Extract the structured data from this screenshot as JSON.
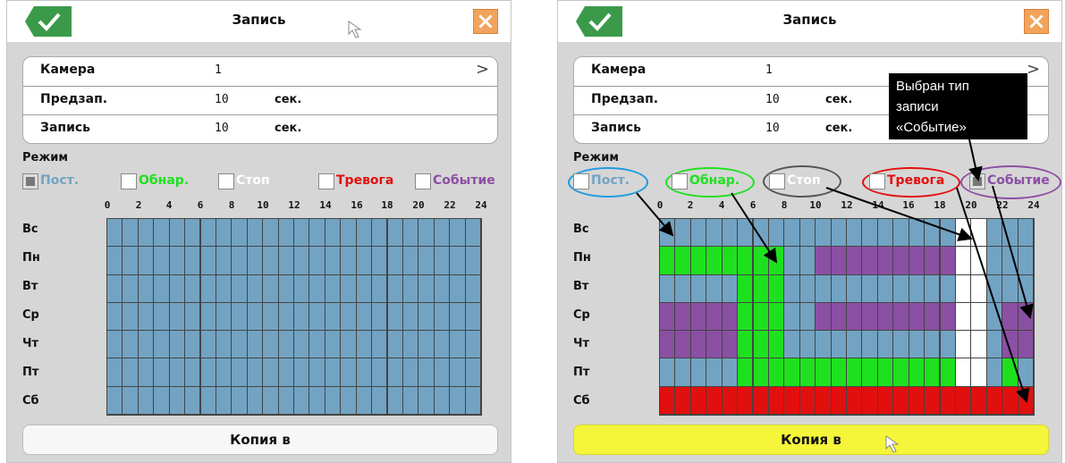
{
  "title": "Запись",
  "settings": {
    "camera": {
      "label": "Камера",
      "value": "1",
      "chevron": ">"
    },
    "prerecord": {
      "label": "Предзап.",
      "value": "10",
      "unit": "сек."
    },
    "record": {
      "label": "Запись",
      "value": "10",
      "unit": "сек."
    }
  },
  "mode_title": "Режим",
  "modes": [
    {
      "label": "Пост.",
      "color": "#72a3c3"
    },
    {
      "label": "Обнар.",
      "color": "#1fe01f"
    },
    {
      "label": "Стоп",
      "color": "#ffffff"
    },
    {
      "label": "Тревога",
      "color": "#e20f0f"
    },
    {
      "label": "Событие",
      "color": "#8b4fa3"
    }
  ],
  "selected_mode": {
    "before": "Пост.",
    "after": "Событие"
  },
  "hour_labels": [
    "0",
    "2",
    "4",
    "6",
    "8",
    "10",
    "12",
    "14",
    "16",
    "18",
    "20",
    "22",
    "24"
  ],
  "days": [
    "Вс",
    "Пн",
    "Вт",
    "Ср",
    "Чт",
    "Пт",
    "Сб"
  ],
  "copy_button": "Копия в",
  "callout": {
    "line1": "Выбран тип",
    "line2": "записи",
    "line3": "«Событие»"
  },
  "schedule_colors": {
    "P": "#72a3c3",
    "G": "#1fe01f",
    "W": "#ffffff",
    "R": "#e20f0f",
    "E": "#8b4fa3"
  },
  "schedule_before": [
    "PPPPPPPPPPPPPPPPPPPPPPPP",
    "PPPPPPPPPPPPPPPPPPPPPPPP",
    "PPPPPPPPPPPPPPPPPPPPPPPP",
    "PPPPPPPPPPPPPPPPPPPPPPPP",
    "PPPPPPPPPPPPPPPPPPPPPPPP",
    "PPPPPPPPPPPPPPPPPPPPPPPP",
    "PPPPPPPPPPPPPPPPPPPPPPPP"
  ],
  "schedule_after": [
    "PPPPPPPPPPPPPPPPPPPWWPPP",
    "GGGGGGGGPPEEEEEEEEEWWPPP",
    "PPPPPGGGPPPPPPPPPPPWWPPP",
    "EEEEEGGGPPEEEEEEEEEWWPEE",
    "EEEEEGGGPPPPPPPPPPPWWPEE",
    "PPPPPGGGGGGGGGGGGGGWWPGP",
    "RRRRRRRRRRRRRRRRRRRRRRRR"
  ]
}
